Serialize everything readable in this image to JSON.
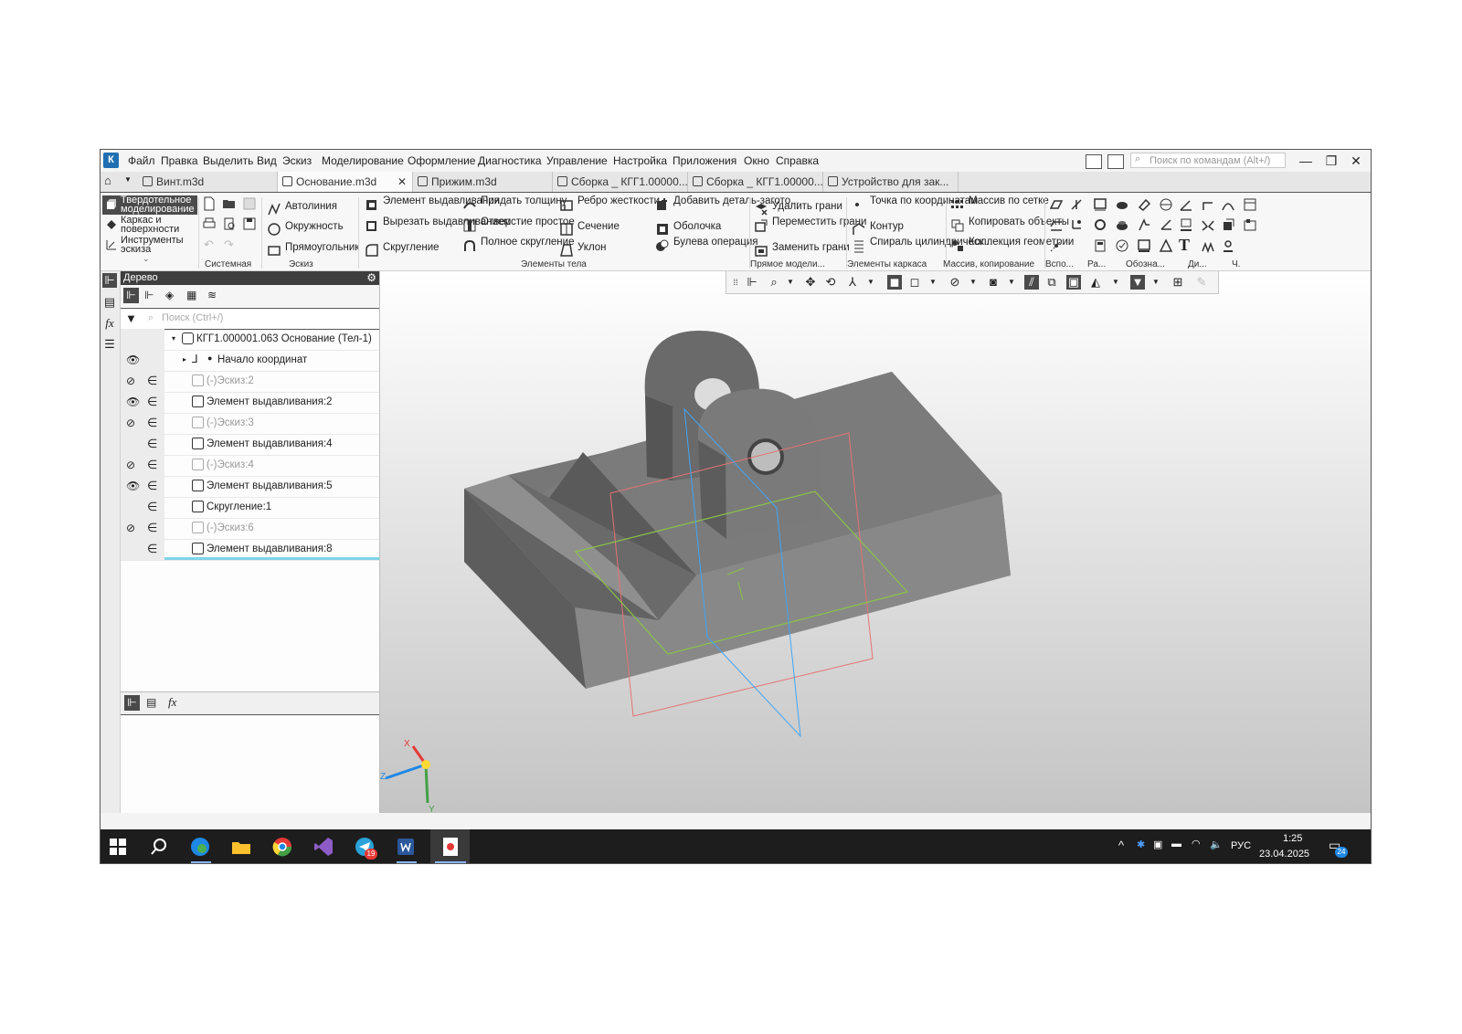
{
  "app": {
    "logo": "К",
    "menu": [
      "Файл",
      "Правка",
      "Выделить",
      "Вид",
      "Эскиз",
      "Моделирование",
      "Оформление",
      "Диагностика",
      "Управление",
      "Настройка",
      "Приложения",
      "Окно",
      "Справка"
    ],
    "search_placeholder": "Поиск по командам (Alt+/)"
  },
  "tabs": [
    {
      "label": "Винт.m3d",
      "active": false
    },
    {
      "label": "Основание.m3d",
      "active": true
    },
    {
      "label": "Прижим.m3d",
      "active": false
    },
    {
      "label": "Сборка _ КГГ1.00000...",
      "active": false
    },
    {
      "label": "Сборка _ КГГ1.00000...",
      "active": false
    },
    {
      "label": "Устройство для зак...",
      "active": false
    }
  ],
  "tab_close": "✕",
  "ribbon": {
    "modes": [
      "Твердотельное моделирование",
      "Каркас и поверхности",
      "Инструменты эскиза"
    ],
    "sketch": [
      "Автолиния",
      "Окружность",
      "Прямоугольник"
    ],
    "body1": [
      "Элемент выдавливания",
      "Вырезать выдавливанием",
      "Скругление"
    ],
    "body2": [
      "Придать толщину",
      "Отверстие простое",
      "Полное скругление"
    ],
    "body3": [
      "Ребро жесткости",
      "Сечение",
      "Уклон"
    ],
    "body4": [
      "Добавить деталь-загото...",
      "Оболочка",
      "Булева операция"
    ],
    "direct": [
      "Удалить грани",
      "Переместить грани",
      "Заменить грани"
    ],
    "frame": [
      "Точка по координатам",
      "Контур",
      "Спираль цилиндрическ..."
    ],
    "array": [
      "Массив по сетке",
      "Копировать объекты",
      "Коллекция геометрии"
    ],
    "groups": [
      "Системная",
      "Эскиз",
      "Элементы тела",
      "Прямое модели...",
      "Элементы каркаса",
      "Массив, копирование",
      "Вспо...",
      "Ра...",
      "Обозна...",
      "Ди...",
      "Ч."
    ]
  },
  "tree": {
    "title": "Дерево",
    "search_placeholder": "Поиск (Ctrl+/)",
    "root": "КГГ1.000001.063 Основание (Тел-1)",
    "origin": "Начало координат",
    "items": [
      {
        "label": "(-)Эскиз:2",
        "eye": "hidden",
        "dim": true
      },
      {
        "label": "Элемент выдавливания:2",
        "eye": "visible",
        "dim": false
      },
      {
        "label": "(-)Эскиз:3",
        "eye": "hidden",
        "dim": true
      },
      {
        "label": "Элемент выдавливания:4",
        "eye": "none",
        "dim": false
      },
      {
        "label": "(-)Эскиз:4",
        "eye": "hidden",
        "dim": true
      },
      {
        "label": "Элемент выдавливания:5",
        "eye": "visible",
        "dim": false
      },
      {
        "label": "Скругление:1",
        "eye": "none",
        "dim": false
      },
      {
        "label": "(-)Эскиз:6",
        "eye": "hidden",
        "dim": true
      },
      {
        "label": "Элемент выдавливания:8",
        "eye": "none",
        "dim": false
      }
    ]
  },
  "axes": {
    "x": "X",
    "y": "Y",
    "z": "Z"
  },
  "taskbar": {
    "lang": "РУС",
    "time": "1:25",
    "date": "23.04.2025",
    "notif": "24",
    "telegram_badge": "19"
  }
}
